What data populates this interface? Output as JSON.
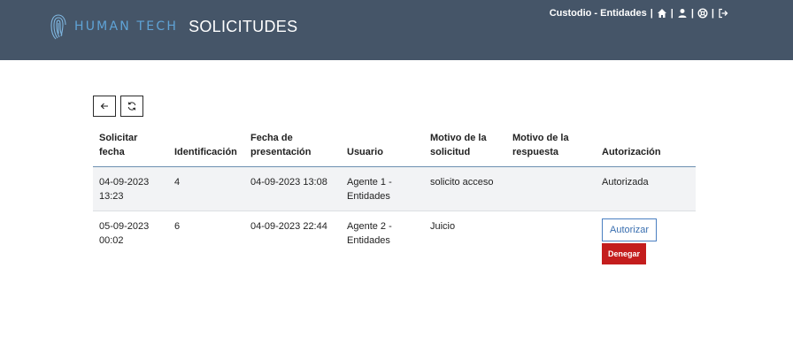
{
  "header": {
    "brand": "HUMAN TECH",
    "title": "SOLICITUDES",
    "user_role": "Custodio - Entidades",
    "icons": [
      "home-icon",
      "user-icon",
      "help-circle-icon",
      "logout-icon"
    ]
  },
  "toolbar": {
    "icons": [
      "back-arrow-icon",
      "refresh-icon"
    ]
  },
  "table": {
    "headers": {
      "solicitar_fecha": "Solicitar fecha",
      "identificacion": "Identificación",
      "fecha_presentacion": "Fecha de presentación",
      "usuario": "Usuario",
      "motivo_solicitud": "Motivo de la solicitud",
      "motivo_respuesta": "Motivo de la respuesta",
      "autorizacion": "Autorización"
    },
    "rows": [
      {
        "solicitar_fecha": "04-09-2023 13:23",
        "identificacion": "4",
        "fecha_presentacion": "04-09-2023 13:08",
        "usuario": "Agente 1 - Entidades",
        "motivo_solicitud": "solicito acceso",
        "motivo_respuesta": "",
        "autorizacion": "Autorizada"
      },
      {
        "solicitar_fecha": "05-09-2023 00:02",
        "identificacion": "6",
        "fecha_presentacion": "04-09-2023 22:44",
        "usuario": "Agente 2 - Entidades",
        "motivo_solicitud": "Juicio",
        "motivo_respuesta": "",
        "authorize_label": "Autorizar",
        "deny_label": "Denegar"
      }
    ]
  },
  "colors": {
    "header_bg": "#455568",
    "brand": "#5fa3d6",
    "authorize_border": "#4a7fc1",
    "deny_bg": "#c41d1d",
    "row_bg": "#f2f3f5"
  }
}
